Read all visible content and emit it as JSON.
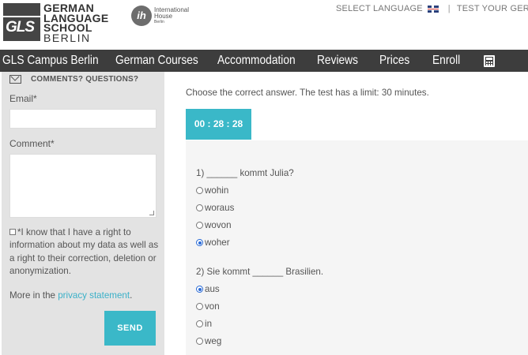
{
  "header": {
    "logo_mark": "GLS",
    "logo_lines": [
      "GERMAN",
      "LANGUAGE",
      "SCHOOL",
      "BERLIN"
    ],
    "partner_mark": "ih",
    "partner_name_1": "International",
    "partner_name_2": "House",
    "partner_city": "Berlin",
    "select_language": "SELECT LANGUAGE",
    "separator": "|",
    "test_link": "TEST YOUR GERMAN"
  },
  "nav": {
    "items": [
      "GLS Campus Berlin",
      "German Courses",
      "Accommodation",
      "Reviews",
      "Prices",
      "Enroll"
    ],
    "calculator_icon": "calculator-icon"
  },
  "sidebar": {
    "heading": "COMMENTS? QUESTIONS?",
    "email_label": "Email*",
    "email_value": "",
    "comment_label": "Comment*",
    "comment_value": "",
    "consent_text": "*I know that I have a right to information about my data as well as a right to their correction, deletion or anonymization.",
    "privacy_prefix": "More in the ",
    "privacy_link": "privacy statement",
    "privacy_suffix": ".",
    "send_label": "SEND"
  },
  "main": {
    "instructions": "Choose the correct answer. The test has a limit: 30 minutes.",
    "timer": "00 : 28 : 28",
    "questions": [
      {
        "text": "1) ______ kommt Julia?",
        "options": [
          "wohin",
          "woraus",
          "wovon",
          "woher"
        ],
        "selected": 3
      },
      {
        "text": "2) Sie kommt ______ Brasilien.",
        "options": [
          "aus",
          "von",
          "in",
          "weg"
        ],
        "selected": 0
      }
    ]
  },
  "colors": {
    "accent": "#3ab8c8",
    "nav_bg": "#3d3d3d",
    "sidebar_bg": "#e3e3e3",
    "quiz_bg": "#f5f5f5"
  }
}
